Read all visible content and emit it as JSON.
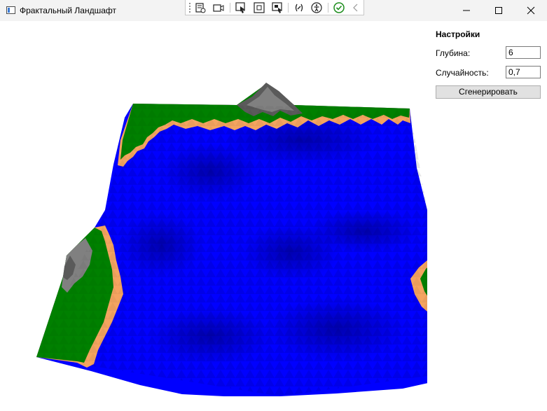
{
  "window": {
    "title": "Фрактальный Ландшафт",
    "icon": "app-window-icon",
    "controls": [
      "minimize-icon",
      "maximize-icon",
      "close-icon"
    ]
  },
  "debug_toolbar": {
    "icons": [
      "live-visual-tree-icon",
      "record-icon",
      "select-element-icon",
      "display-layout-adorners-icon",
      "track-focused-element-icon",
      "binding-failures-icon",
      "accessibility-icon",
      "hot-reload-check-icon",
      "collapse-chevron-icon"
    ]
  },
  "settings": {
    "header": "Настройки",
    "depth_label": "Глубина:",
    "depth_value": "6",
    "randomness_label": "Случайность:",
    "randomness_value": "0,7",
    "generate_button": "Сгенерировать"
  },
  "terrain": {
    "colors": {
      "water": "#0000ff",
      "water_dark": "#0000b4",
      "sand": "#f4a460",
      "grass": "#008000",
      "rock": "#808080",
      "rock_dark": "#5a5a5a"
    }
  }
}
